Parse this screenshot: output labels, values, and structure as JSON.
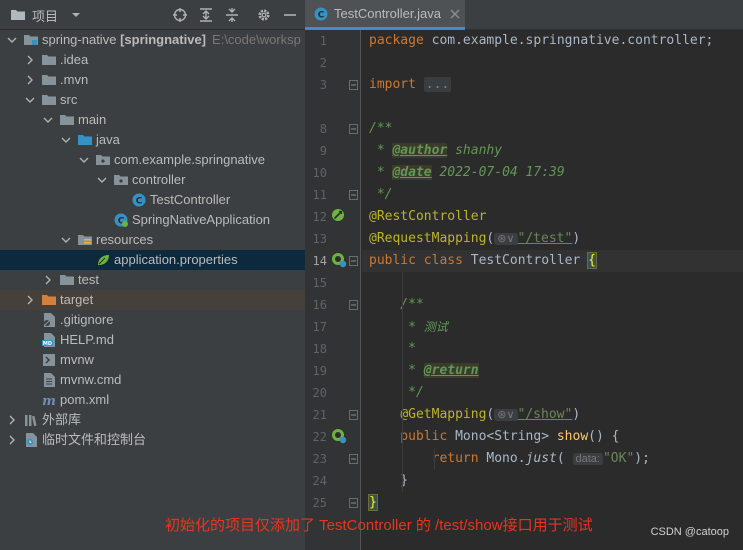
{
  "project_panel": {
    "title": "项目",
    "tree": [
      {
        "label": "spring-native",
        "suffix": "[springnative]",
        "path": "E:\\code\\worksp",
        "depth": 0,
        "expanded": true,
        "icon": "module-folder"
      },
      {
        "label": ".idea",
        "depth": 1,
        "expanded": false,
        "icon": "folder"
      },
      {
        "label": ".mvn",
        "depth": 1,
        "expanded": false,
        "icon": "folder"
      },
      {
        "label": "src",
        "depth": 1,
        "expanded": true,
        "icon": "folder"
      },
      {
        "label": "main",
        "depth": 2,
        "expanded": true,
        "icon": "folder"
      },
      {
        "label": "java",
        "depth": 3,
        "expanded": true,
        "icon": "source-folder"
      },
      {
        "label": "com.example.springnative",
        "depth": 4,
        "expanded": true,
        "icon": "package"
      },
      {
        "label": "controller",
        "depth": 5,
        "expanded": true,
        "icon": "package"
      },
      {
        "label": "TestController",
        "depth": 6,
        "icon": "class"
      },
      {
        "label": "SpringNativeApplication",
        "depth": 5,
        "icon": "spring-class"
      },
      {
        "label": "resources",
        "depth": 3,
        "expanded": true,
        "icon": "resources-folder"
      },
      {
        "label": "application.properties",
        "depth": 4,
        "icon": "spring-properties",
        "selected": true
      },
      {
        "label": "test",
        "depth": 2,
        "expanded": false,
        "icon": "folder"
      },
      {
        "label": "target",
        "depth": 1,
        "expanded": false,
        "icon": "excluded-folder",
        "highlighted": true
      },
      {
        "label": ".gitignore",
        "depth": 1,
        "icon": "gitignore-file"
      },
      {
        "label": "HELP.md",
        "depth": 1,
        "icon": "markdown-file"
      },
      {
        "label": "mvnw",
        "depth": 1,
        "icon": "script-file"
      },
      {
        "label": "mvnw.cmd",
        "depth": 1,
        "icon": "text-file"
      },
      {
        "label": "pom.xml",
        "depth": 1,
        "icon": "maven-file"
      },
      {
        "label": "外部库",
        "depth": 0,
        "expanded": false,
        "icon": "library"
      },
      {
        "label": "临时文件和控制台",
        "depth": 0,
        "expanded": false,
        "icon": "scratches"
      }
    ]
  },
  "editor": {
    "tab_label": "TestController.java",
    "line_numbers": [
      "1",
      "2",
      "3",
      "8",
      "9",
      "10",
      "11",
      "12",
      "13",
      "14",
      "15",
      "16",
      "17",
      "18",
      "19",
      "20",
      "21",
      "22",
      "23",
      "24",
      "25"
    ],
    "current_line": "14",
    "code": {
      "l1_kw": "package",
      "l1_rest": " com.example.springnative.controller;",
      "l3_kw": "import",
      "l3_fold": "...",
      "l8": "/**",
      "l9_pre": " * ",
      "l9_tag": "@author",
      "l9_val": " shanhy",
      "l10_pre": " * ",
      "l10_tag": "@date",
      "l10_val": " 2022-07-04 17:39",
      "l11": " */",
      "l12": "@RestController",
      "l13_ann": "@RequestMapping",
      "l13_open": "(",
      "l13_icon": "⊛∨",
      "l13_str": "\"/test\"",
      "l13_close": ")",
      "l14_kw": "public class",
      "l14_name": " TestController ",
      "l14_brace": "{",
      "l16": "    /**",
      "l17_pre": "     * ",
      "l17_val": "测试",
      "l18": "     *",
      "l19_pre": "     * ",
      "l19_tag": "@return",
      "l20": "     */",
      "l21_indent": "    ",
      "l21_ann": "@GetMapping",
      "l21_open": "(",
      "l21_icon": "⊛∨",
      "l21_str": "\"/show\"",
      "l21_close": ")",
      "l22_kw": "    public",
      "l22_type": " Mono<String> ",
      "l22_meth": "show",
      "l22_rest": "() {",
      "l23_kw": "        return",
      "l23_mid": " Mono.",
      "l23_stat": "just",
      "l23_open": "( ",
      "l23_hint": "data:",
      "l23_str": "\"OK\"",
      "l23_close": ");",
      "l24": "    }",
      "l25": "}"
    }
  },
  "caption": "初始化的项目仅添加了 TestController 的 /test/show接口用于测试",
  "watermark": "CSDN @catoop"
}
